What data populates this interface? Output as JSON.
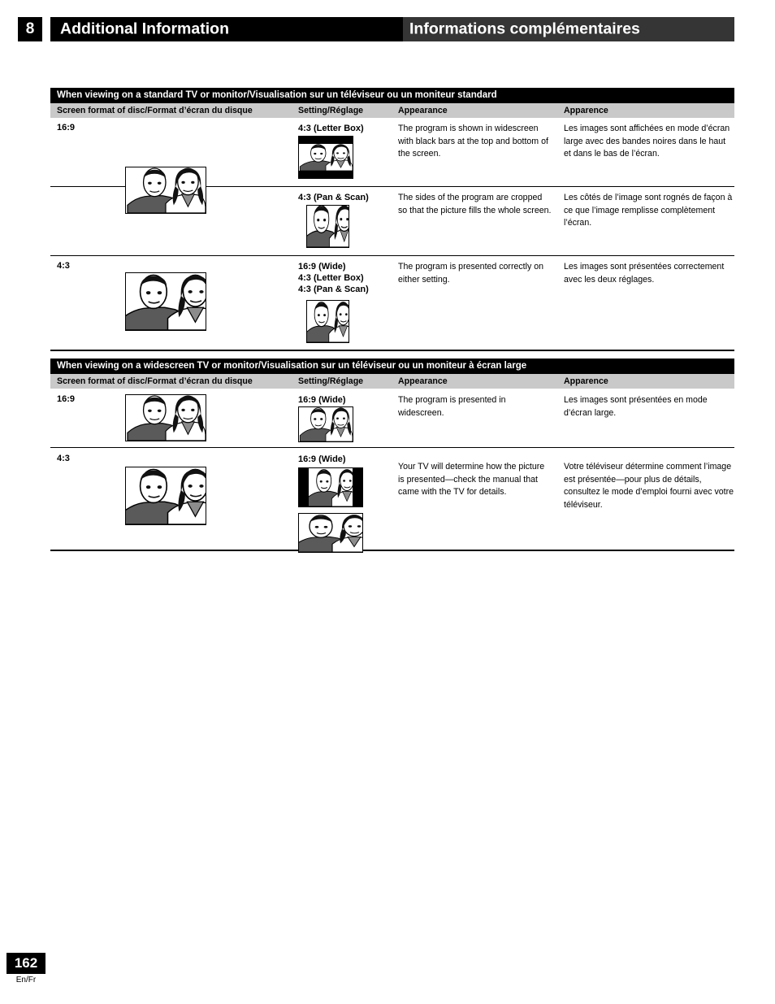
{
  "header": {
    "chapter_number": "8",
    "title_en": "Additional Information",
    "title_fr": "Informations complémentaires"
  },
  "tables": [
    {
      "band": "When viewing on a standard TV or monitor/Visualisation sur un téléviseur ou un moniteur standard",
      "columns": {
        "format": "Screen format of disc/Format d’écran du disque",
        "setting": "Setting/Réglage",
        "appearance": "Appearance",
        "apparence": "Apparence"
      },
      "rows": [
        {
          "format": "16:9",
          "setting": "4:3 (Letter Box)",
          "appearance": "The program is shown in widescreen with black bars at the top and bottom of the screen.",
          "apparence": "Les images sont affichées en mode d’écran large avec des bandes noires dans le haut et dans le bas de l’écran."
        },
        {
          "format": "",
          "setting": "4:3 (Pan & Scan)",
          "appearance": "The sides of the program are cropped so that the picture fills the whole screen.",
          "apparence": "Les côtés de l’image sont rognés de façon à ce que l’image remplisse complètement l’écran."
        },
        {
          "format": "4:3",
          "setting": "16:9 (Wide)",
          "setting2": "4:3 (Letter Box)",
          "setting3": "4:3 (Pan & Scan)",
          "appearance": "The program is presented correctly on either setting.",
          "apparence": "Les images sont présentées correctement avec les deux réglages."
        }
      ]
    },
    {
      "band": "When viewing on a widescreen TV or monitor/Visualisation sur un téléviseur ou un moniteur à écran large",
      "columns": {
        "format": "Screen format of disc/Format d’écran du disque",
        "setting": "Setting/Réglage",
        "appearance": "Appearance",
        "apparence": "Apparence"
      },
      "rows": [
        {
          "format": "16:9",
          "setting": "16:9 (Wide)",
          "appearance": "The program is presented in widescreen.",
          "apparence": "Les images sont présentées en mode d’écran large."
        },
        {
          "format": "4:3",
          "setting": "16:9 (Wide)",
          "appearance": "Your TV will determine how the picture is presented—check the manual that came with the TV for details.",
          "apparence": "Votre téléviseur détermine comment l’image est présentée—pour plus de détails, consultez le mode d’emploi fourni avec votre téléviseur."
        }
      ]
    }
  ],
  "footer": {
    "page_number": "162",
    "language": "En/Fr"
  },
  "colors": {
    "band_bg": "#000000",
    "col_head_bg": "#c9c9c9",
    "title_fr_bg": "#353535"
  }
}
